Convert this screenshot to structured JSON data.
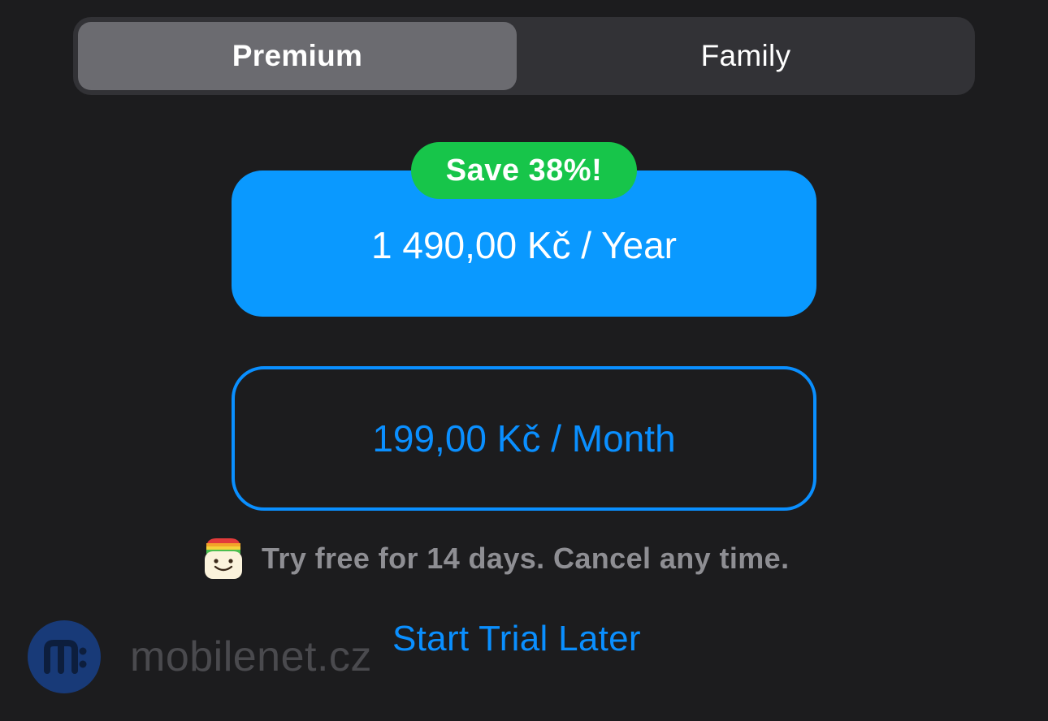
{
  "segmented_control": {
    "options": [
      {
        "label": "Premium",
        "selected": true
      },
      {
        "label": "Family",
        "selected": false
      }
    ]
  },
  "plans": {
    "yearly": {
      "badge": "Save 38%!",
      "price": "1 490,00 Kč / Year"
    },
    "monthly": {
      "price": "199,00 Kč / Month"
    }
  },
  "trial": {
    "icon": "app-face-icon",
    "text": "Try free for 14 days. Cancel any time."
  },
  "actions": {
    "later_label": "Start Trial Later"
  },
  "watermark": {
    "text": "mobilenet.cz"
  },
  "colors": {
    "background": "#1c1c1e",
    "accent_blue": "#0a99ff",
    "badge_green": "#17c54a",
    "muted_text": "#8e8e93"
  }
}
